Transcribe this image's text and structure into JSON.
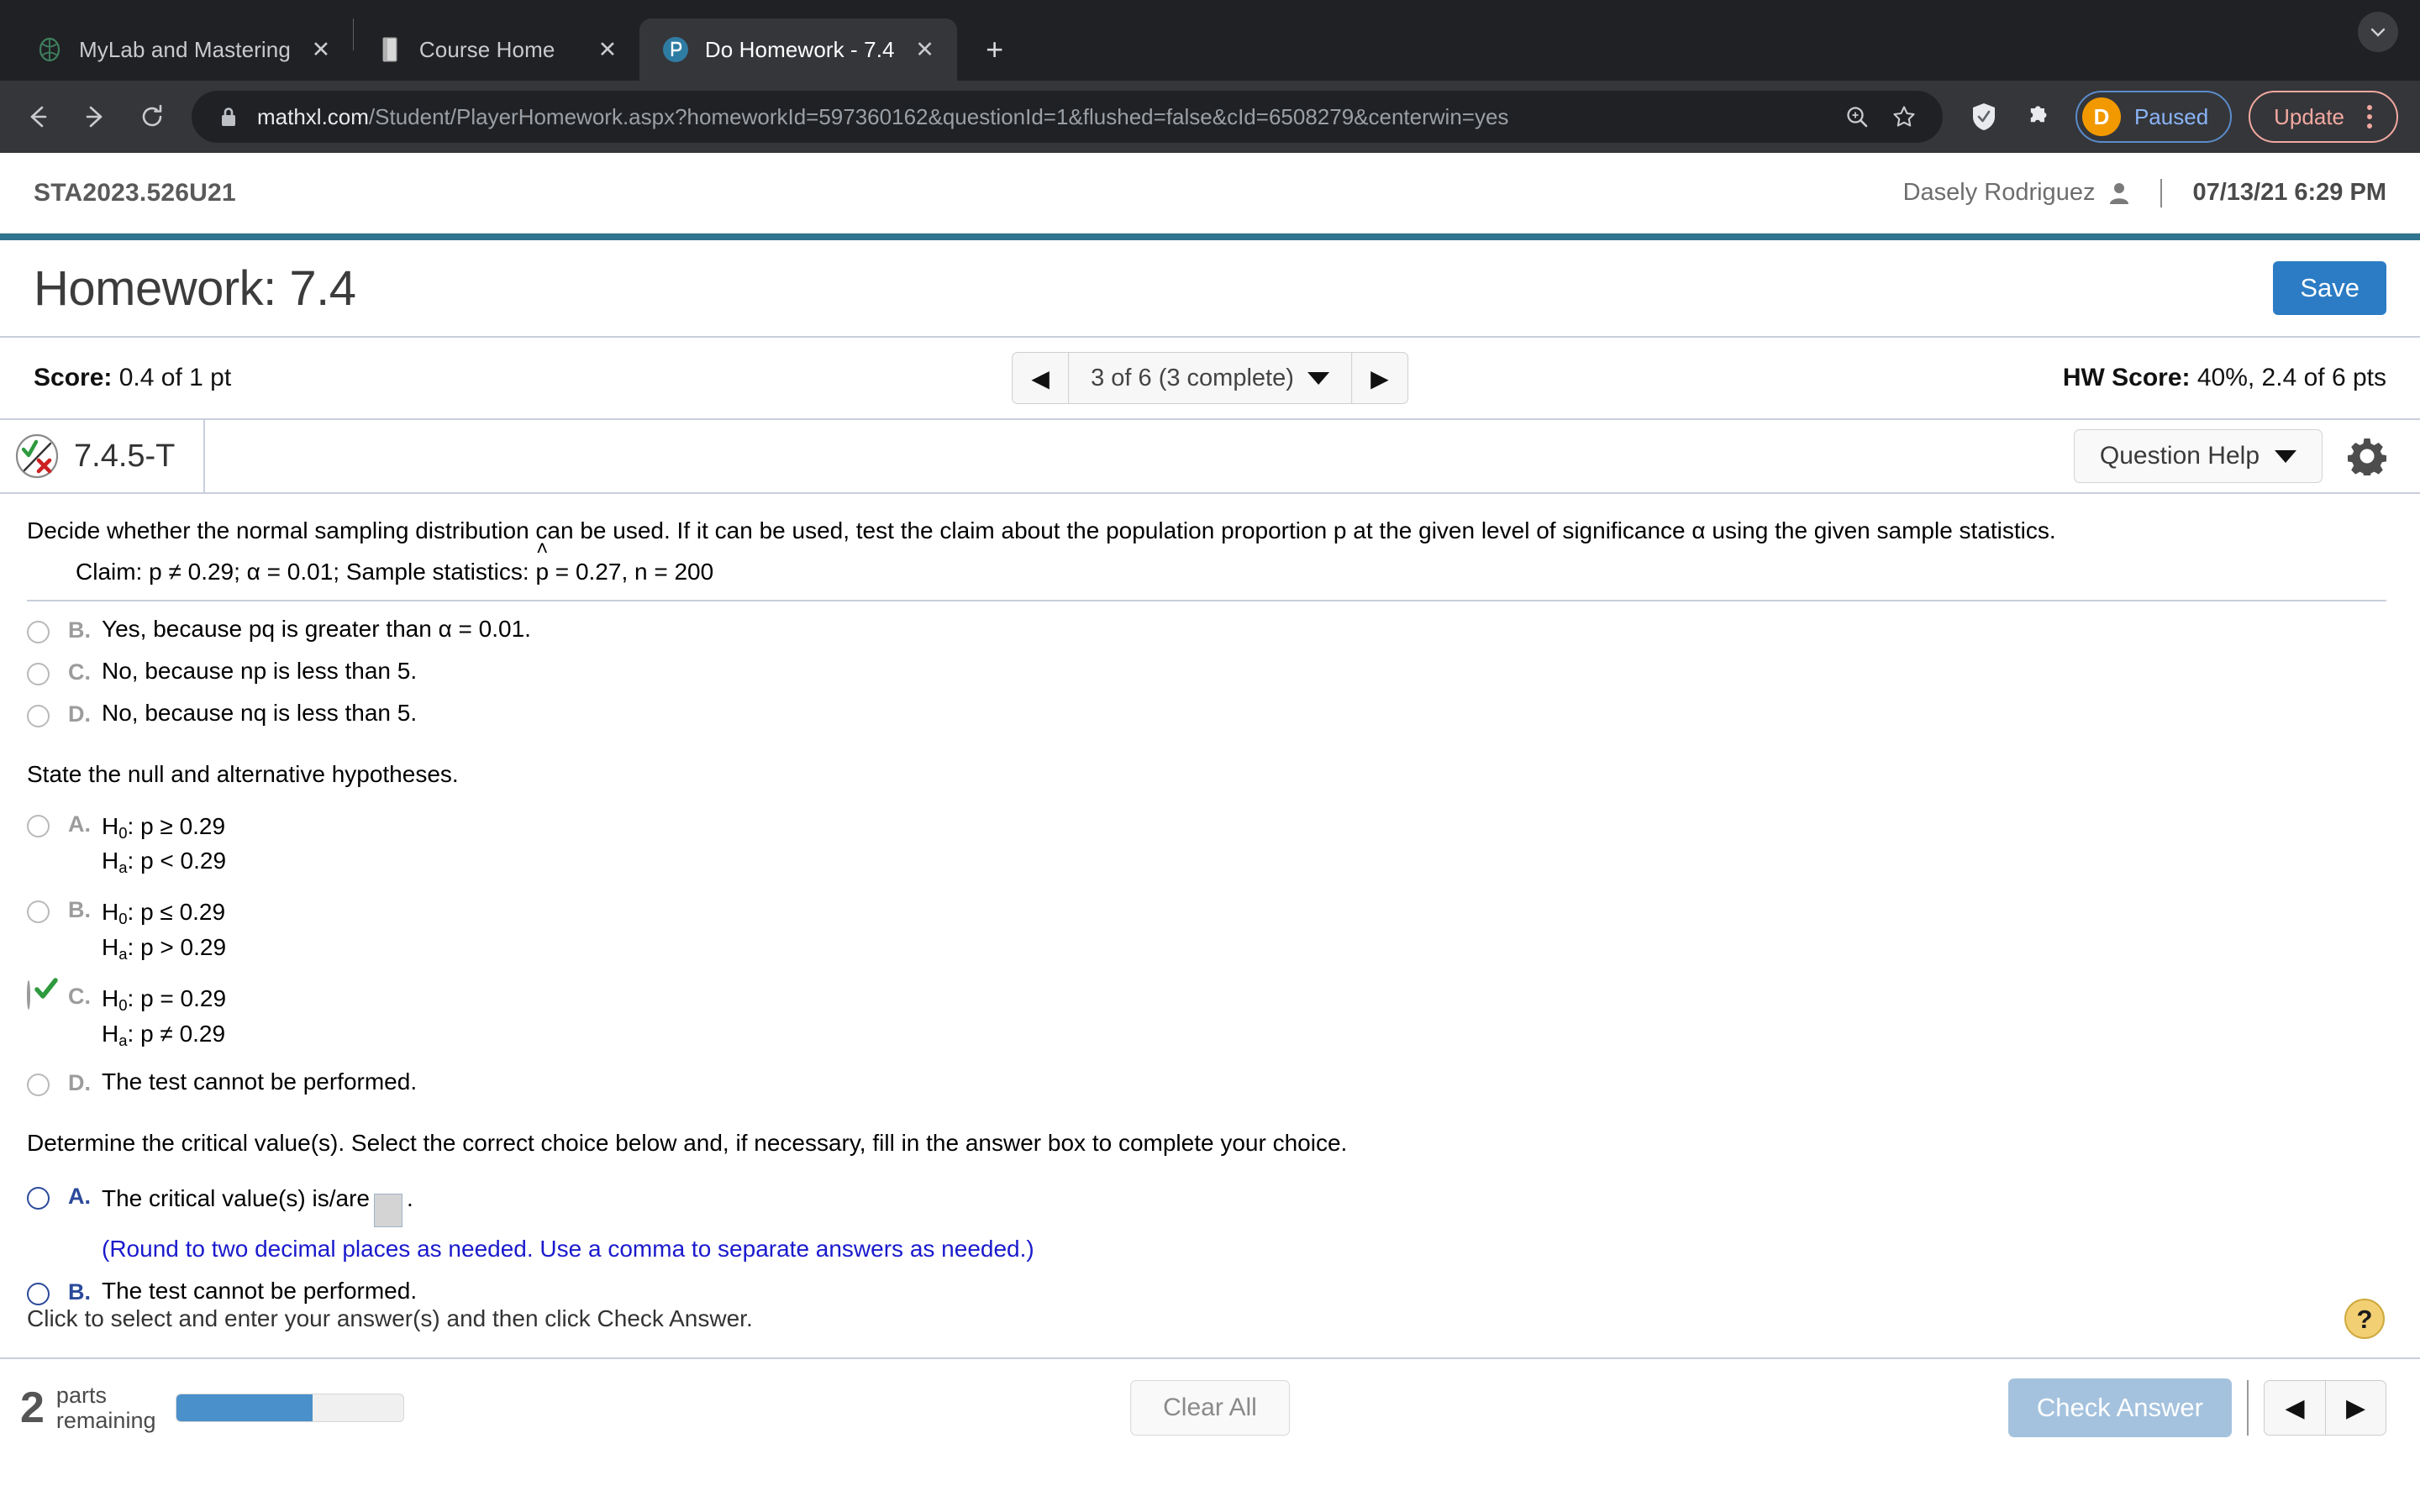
{
  "browser": {
    "tabs": [
      {
        "title": "MyLab and Mastering",
        "favicon": "mylab-icon",
        "active": false
      },
      {
        "title": "Course Home",
        "favicon": "book-icon",
        "active": false
      },
      {
        "title": "Do Homework - 7.4",
        "favicon": "pearson-icon",
        "active": true
      }
    ],
    "new_tab_label": "+",
    "close_label": "✕",
    "window_control": "minimize-icon",
    "nav": {
      "back": "←",
      "forward": "→",
      "reload": "↻"
    },
    "url_host": "mathxl.com",
    "url_path": "/Student/PlayerHomework.aspx?homeworkId=597360162&questionId=1&flushed=false&cId=6508279&centerwin=yes",
    "profile": {
      "initial": "D",
      "label": "Paused"
    },
    "update_label": "Update"
  },
  "header": {
    "course_id": "STA2023.526U21",
    "user_name": "Dasely Rodriguez",
    "datetime": "07/13/21 6:29 PM"
  },
  "title_bar": {
    "title": "Homework: 7.4",
    "save_label": "Save"
  },
  "score_bar": {
    "score_label": "Score:",
    "score_value": "0.4 of 1 pt",
    "pager_text": "3 of 6 (3 complete)",
    "prev_label": "◀",
    "next_label": "▶",
    "hw_score_label": "HW Score:",
    "hw_score_value": "40%, 2.4 of 6 pts"
  },
  "question_bar": {
    "status_icon": "partial-credit-icon",
    "question_id": "7.4.5-T",
    "help_label": "Question Help",
    "settings_icon": "gear-icon"
  },
  "question": {
    "prompt": "Decide whether the normal sampling distribution can be used. If it can be used, test the claim about the population proportion p at the given level of significance α using the given sample statistics.",
    "claim_prefix": "Claim: p ≠ 0.29; α = 0.01; Sample statistics: ",
    "claim_phat": "p",
    "claim_hat": "˄",
    "claim_suffix": " = 0.27, n = 200",
    "part1_options": [
      {
        "letter": "B.",
        "text": "Yes, because pq is greater than α = 0.01.",
        "state": "unselected"
      },
      {
        "letter": "C.",
        "text": "No, because np is less than 5.",
        "state": "unselected"
      },
      {
        "letter": "D.",
        "text": "No, because nq is less than 5.",
        "state": "unselected"
      }
    ],
    "part2_prompt": "State the null and alternative hypotheses.",
    "part2_options": [
      {
        "letter": "A.",
        "line1_h": "H",
        "line1_sub": "0",
        "line1_rest": ": p ≥ 0.29",
        "line2_h": "H",
        "line2_sub": "a",
        "line2_rest": ": p < 0.29",
        "state": "unselected"
      },
      {
        "letter": "B.",
        "line1_h": "H",
        "line1_sub": "0",
        "line1_rest": ": p ≤ 0.29",
        "line2_h": "H",
        "line2_sub": "a",
        "line2_rest": ": p > 0.29",
        "state": "unselected"
      },
      {
        "letter": "C.",
        "line1_h": "H",
        "line1_sub": "0",
        "line1_rest": ": p = 0.29",
        "line2_h": "H",
        "line2_sub": "a",
        "line2_rest": ": p ≠ 0.29",
        "state": "selected-correct"
      },
      {
        "letter": "D.",
        "line1_h": "",
        "line1_sub": "",
        "line1_rest": "The test cannot be performed.",
        "line2_h": "",
        "line2_sub": "",
        "line2_rest": "",
        "state": "unselected"
      }
    ],
    "part3_prompt": "Determine the critical value(s). Select the correct choice below and, if necessary, fill in the answer box to complete your choice.",
    "part3_options": [
      {
        "letter": "A.",
        "text_before": "The critical value(s) is/are",
        "answer_value": "",
        "text_after": ".",
        "hint": "(Round to two decimal places as needed. Use a comma to separate answers as needed.)",
        "state": "active"
      },
      {
        "letter": "B.",
        "text_before": "The test cannot be performed.",
        "answer_value": null,
        "text_after": "",
        "hint": "",
        "state": "active"
      }
    ]
  },
  "prompt_bar": {
    "text": "Click to select and enter your answer(s) and then click Check Answer.",
    "help_icon": "question-mark-help-icon"
  },
  "footer": {
    "parts_count": "2",
    "parts_label_line1": "parts",
    "parts_label_line2": "remaining",
    "progress_percent": 60,
    "clear_all_label": "Clear All",
    "check_answer_label": "Check Answer",
    "prev_label": "◀",
    "next_label": "▶"
  },
  "colors": {
    "accent": "#31748f",
    "save_blue": "#2b7cc4",
    "progress_blue": "#4a90ca",
    "check_disabled": "#a4c2de",
    "hint_blue": "#1a1acd",
    "option_blue": "#2b4a9b"
  }
}
